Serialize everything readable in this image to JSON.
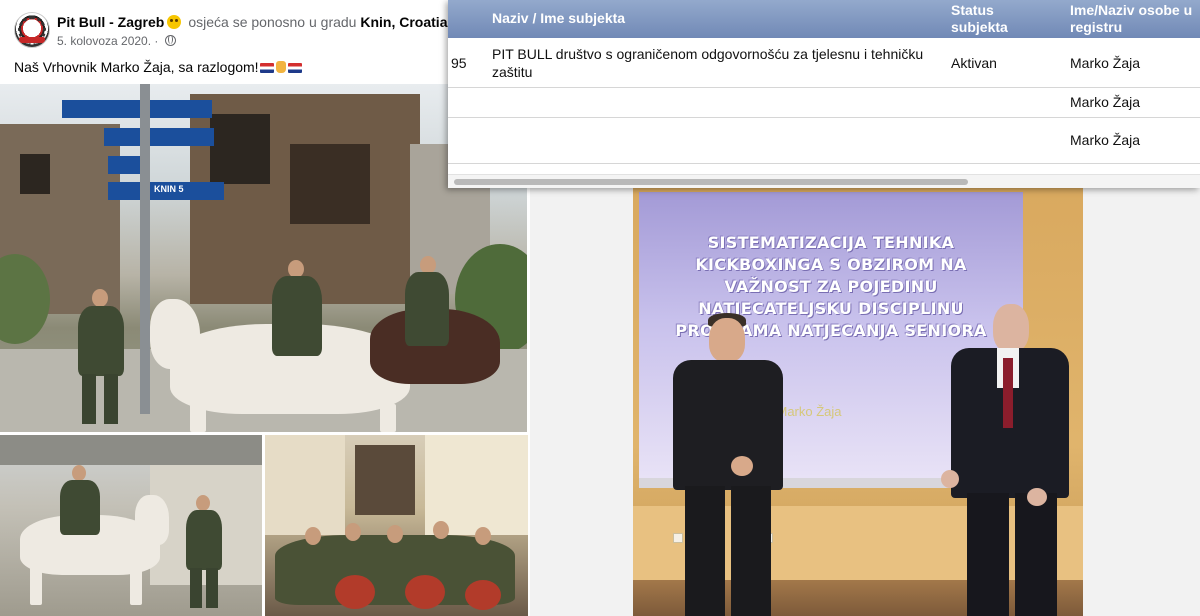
{
  "post": {
    "page_name": "Pit Bull - Zagreb",
    "feeling": "osjeća se ponosno u gradu",
    "location": "Knin, Croatia",
    "date": "5. kolovoza 2020.",
    "text": "Naš Vrhovnik Marko Žaja, sa razlogom!"
  },
  "photos": {
    "signs": [
      "",
      "",
      "",
      "",
      "",
      "",
      "KNIN 5"
    ]
  },
  "registry": {
    "headers": {
      "name": "Naziv / Ime subjekta",
      "status": "Status subjekta",
      "person": "Ime/Naziv osobe u registru"
    },
    "rows": [
      {
        "num": "95",
        "name": "PIT BULL društvo s ograničenom odgovornošću za tjelesnu i tehničku zaštitu",
        "status": "Aktivan",
        "person": "Marko Žaja"
      },
      {
        "num": "",
        "name": "",
        "status": "",
        "person": "Marko Žaja"
      },
      {
        "num": "",
        "name": "",
        "status": "",
        "person": "Marko Žaja"
      }
    ]
  },
  "slide": {
    "title": "SISTEMATIZACIJA TEHNIKA KICKBOXINGA S OBZIROM NA VAŽNOST ZA POJEDINU NATJECATELJSKU DISCIPLINU PROGRAMA NATJECANJA SENIORA",
    "author": "Marko Žaja"
  },
  "colors": {
    "table_header": "#7f96c1",
    "slide_bg": "#b9b1e3",
    "sign_blue": "#1b4f9c"
  }
}
